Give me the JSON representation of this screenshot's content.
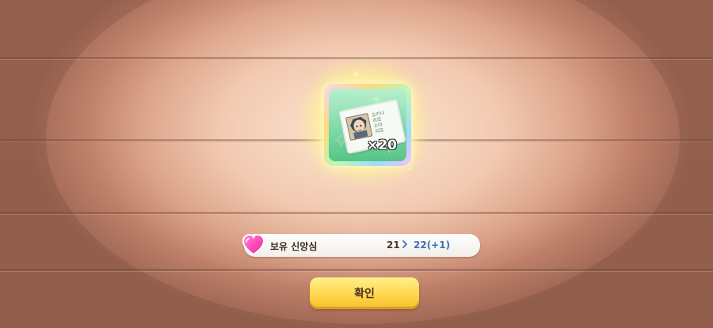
{
  "reward": {
    "item_name": "sketch-ticket-icon",
    "quantity_text": "×20",
    "ticket_text_lines": [
      "오키나",
      "리모",
      "소마",
      "리모"
    ]
  },
  "faith": {
    "icon": "heart-gem-icon",
    "label": "보유 신앙심",
    "current": "21",
    "arrow": "chevron-right-icon",
    "next": "22(+1)"
  },
  "actions": {
    "confirm_label": "확인"
  },
  "colors": {
    "accent_button": "#ffd54a",
    "faith_next": "#3d6fb6",
    "heart": "#ff47b8"
  }
}
